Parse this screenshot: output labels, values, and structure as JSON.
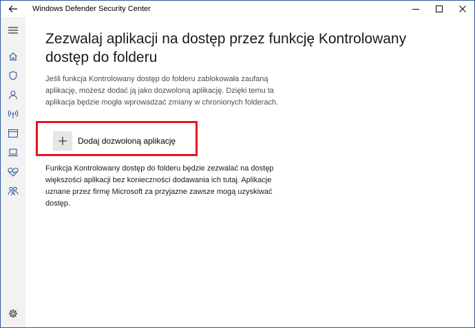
{
  "window": {
    "title": "Windows Defender Security Center",
    "accent_color": "#2b579a",
    "highlight_color": "#e81123"
  },
  "titlebar": {
    "back_icon": "arrow-left-icon",
    "minimize_icon": "minimize-icon",
    "maximize_icon": "maximize-icon",
    "close_icon": "close-icon"
  },
  "sidebar": {
    "items": [
      {
        "icon": "hamburger-menu-icon"
      },
      {
        "icon": "home-icon"
      },
      {
        "icon": "shield-icon"
      },
      {
        "icon": "person-icon"
      },
      {
        "icon": "wireless-signal-icon"
      },
      {
        "icon": "app-browser-window-icon"
      },
      {
        "icon": "laptop-icon"
      },
      {
        "icon": "heart-health-icon"
      },
      {
        "icon": "family-icon"
      },
      {
        "icon": "settings-gear-icon"
      }
    ]
  },
  "main": {
    "title": "Zezwalaj aplikacji na dostęp przez funkcję Kontrolowany dostęp do folderu",
    "description": "Jeśli funkcja Kontrolowany dostęp do folderu zablokowała zaufaną aplikację, możesz dodać ją jako dozwoloną aplikację. Dzięki temu ta aplikacja będzie mogła wprowadzać zmiany w chronionych folderach.",
    "add_button_label": "Dodaj dozwoloną aplikację",
    "info": "Funkcja Kontrolowany dostęp do folderu będzie zezwalać na dostęp większości aplikacji bez konieczności dodawania ich tutaj. Aplikacje uznane przez firmę Microsoft za przyjazne zawsze mogą uzyskiwać dostęp."
  }
}
